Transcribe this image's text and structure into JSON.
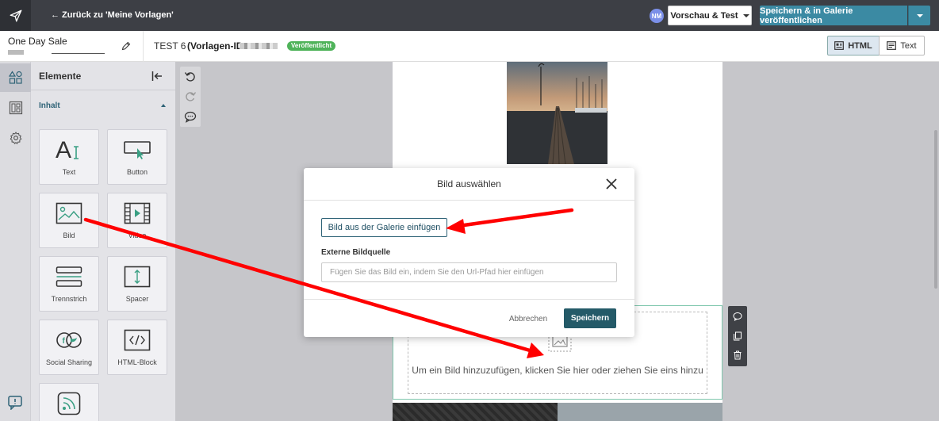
{
  "topbar": {
    "back_label": "← Zurück zu 'Meine Vorlagen'",
    "avatar_initials": "NM",
    "preview_label": "Vorschau & Test",
    "publish_label": "Speichern & in Galerie veröffentlichen",
    "colors": {
      "bar": "#3d3f45",
      "publish": "#3b8aa3",
      "avatar": "#7b8fe8"
    }
  },
  "subbar": {
    "template_name": "One Day Sale",
    "template_title": "TEST 6",
    "template_id_label": "(Vorlagen-ID:",
    "status_badge": "Veröffentlicht",
    "view_html": "HTML",
    "view_text": "Text"
  },
  "rail": {
    "items": [
      "shapes-icon",
      "layout-icon",
      "gear-icon"
    ],
    "help_icon": "feedback-icon"
  },
  "panel": {
    "title": "Elemente",
    "section": "Inhalt",
    "tiles": [
      {
        "label": "Text",
        "icon": "text-icon"
      },
      {
        "label": "Button",
        "icon": "button-icon"
      },
      {
        "label": "Bild",
        "icon": "image-icon"
      },
      {
        "label": "Video",
        "icon": "video-icon"
      },
      {
        "label": "Trennstrich",
        "icon": "divider-icon"
      },
      {
        "label": "Spacer",
        "icon": "spacer-icon"
      },
      {
        "label": "Social Sharing",
        "icon": "social-icon"
      },
      {
        "label": "HTML-Block",
        "icon": "code-icon"
      },
      {
        "label": "",
        "icon": "rss-icon"
      }
    ]
  },
  "canvas": {
    "image_placeholder": "Um ein Bild hinzuzufügen, klicken Sie hier oder ziehen Sie eins hinzu",
    "highlight_color": "#7fc7ad"
  },
  "modal": {
    "title": "Bild auswählen",
    "gallery_button": "Bild aus der Galerie einfügen",
    "external_label": "Externe Bildquelle",
    "external_placeholder": "Fügen Sie das Bild ein, indem Sie den Url-Pfad hier einfügen",
    "external_value": "",
    "cancel_label": "Abbrechen",
    "save_label": "Speichern",
    "save_color": "#245a68"
  },
  "annotations": {
    "arrow_color": "#ff0000"
  }
}
